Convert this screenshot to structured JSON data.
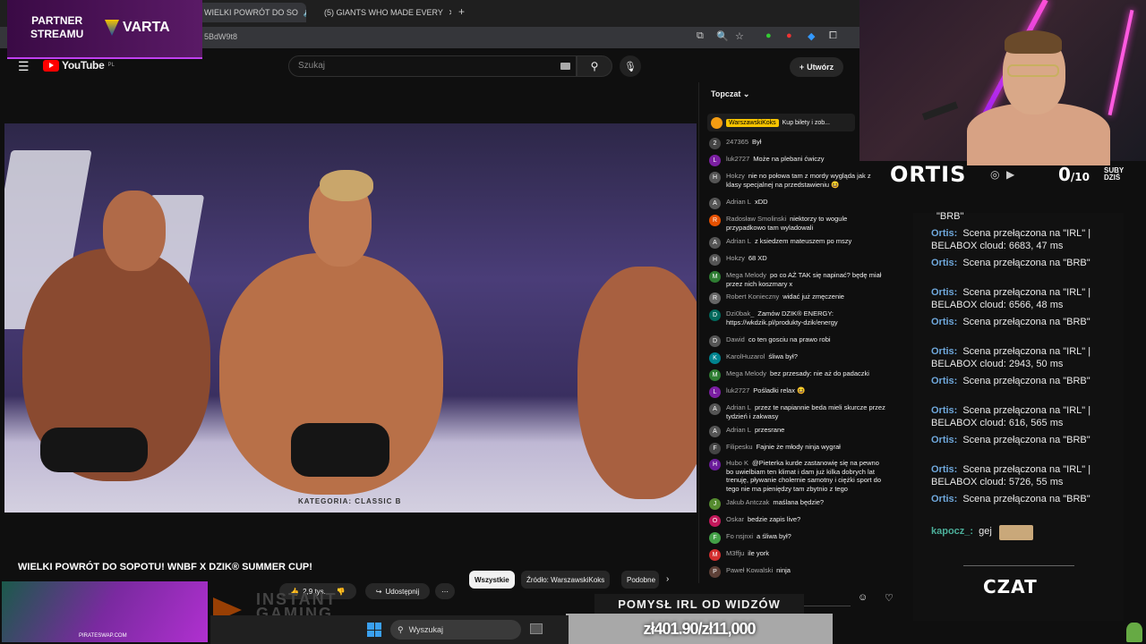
{
  "browser": {
    "tabs": [
      {
        "label": "WIELKI POWRÓT DO SO",
        "active": true
      },
      {
        "label": "(5) GIANTS WHO MADE EVERY",
        "active": false
      }
    ],
    "url_fragment": "5BdW9t8",
    "new_tab": "+"
  },
  "youtube": {
    "logo": "YouTube",
    "logo_region": "PL",
    "search_placeholder": "Szukaj",
    "create_label": "Utwórz"
  },
  "video": {
    "overlay_text": "KATEGORIA: CLASSIC B",
    "title": "WIELKI POWRÓT DO SOPOTU! WNBF X DZIK® SUMMER CUP!",
    "likes": "2,9 tys.",
    "share_label": "Udostępnij",
    "more": "⋯"
  },
  "chips": [
    "Wszystkie",
    "Źródło: WarszawskiKoks",
    "Podobne"
  ],
  "live_chat": {
    "header": "Topczat",
    "pinned": {
      "author": "WarszawskiKoks",
      "text": "Kup bilety i zob..."
    },
    "messages": [
      {
        "author": "247365",
        "text": "Był",
        "color": "#444"
      },
      {
        "author": "luk2727",
        "text": "Może na plebani ćwiczy",
        "color": "#7b1fa2"
      },
      {
        "author": "Hokzy",
        "text": "nie no połowa tam z mordy wygląda jak z klasy specjalnej na przedstawieniu 😆",
        "color": "#555"
      },
      {
        "author": "Adrian L",
        "text": "xDD",
        "color": "#555"
      },
      {
        "author": "Radosław Smolinski",
        "text": "niektorzy to wogule przypadkowo tam wyladowali",
        "color": "#e65100"
      },
      {
        "author": "Adrian L",
        "text": "z ksiedzem mateuszem po mszy",
        "color": "#555"
      },
      {
        "author": "Hokzy",
        "text": "68 XD",
        "color": "#555"
      },
      {
        "author": "Mega Melody",
        "text": "po co AŻ TAK się napinać? będę miał przez nich koszmary x",
        "color": "#2e7d32"
      },
      {
        "author": "Robert Konieczny",
        "text": "widać już zmęczenie",
        "color": "#666"
      },
      {
        "author": "Dzi0bak_",
        "text": "Zamów DZIK® ENERGY: https://wkdzik.pl/produkty-dzik/energy",
        "color": "#00695c"
      },
      {
        "author": "Dawid",
        "text": "co ten gosciu na prawo robi",
        "color": "#555"
      },
      {
        "author": "KarolHuzarol",
        "text": "śliwa był?",
        "color": "#00838f"
      },
      {
        "author": "Mega Melody",
        "text": "bez przesady: nie aż do padaczki",
        "color": "#2e7d32"
      },
      {
        "author": "luk2727",
        "text": "Pośladki relax 😆",
        "color": "#7b1fa2"
      },
      {
        "author": "Adrian L",
        "text": "przez te napiannie beda mieli skurcze przez tydzień i zakwasy",
        "color": "#555"
      },
      {
        "author": "Adrian L",
        "text": "przesrane",
        "color": "#555"
      },
      {
        "author": "Filipesku",
        "text": "Fajnie że młody ninja wygrał",
        "color": "#444"
      },
      {
        "author": "Hubo K",
        "text": "@Pieterka kurde zastanowię się na pewno bo uwielbiam ten klimat i dam już kilka dobrych lat trenuję, pływanie cholernie samotny i ciężki sport do tego nie ma pieniędzy tam zbytnio z tego",
        "color": "#6a1b9a"
      },
      {
        "author": "Jakub Antczak",
        "text": "maślana będzie?",
        "color": "#558b2f"
      },
      {
        "author": "Oskar",
        "text": "bedzie zapis live?",
        "color": "#c2185b"
      },
      {
        "author": "Fo nsjnxi",
        "text": "a śliwa był?",
        "color": "#43a047"
      },
      {
        "author": "M3ffju",
        "text": "ile york",
        "color": "#d32f2f"
      },
      {
        "author": "Paweł Kowalski",
        "text": "ninja",
        "color": "#5d4037"
      }
    ]
  },
  "stream_overlay": {
    "partner_text": "PARTNER\nSTREAMU",
    "sponsor": "VARTA",
    "streamer": "ORTIS",
    "subs_count": "0",
    "subs_goal": "/10",
    "subs_label_1": "SUBY",
    "subs_label_2": "DZIŚ",
    "chat_title": "CZAT",
    "bot_messages": [
      {
        "name": "",
        "text": "\"BRB\""
      },
      {
        "name": "Ortis:",
        "text": "Scena przełączona na \"IRL\" | BELABOX cloud: 6683, 47 ms"
      },
      {
        "name": "Ortis:",
        "text": "Scena przełączona na \"BRB\""
      },
      {
        "name": "Ortis:",
        "text": "Scena przełączona na \"IRL\" | BELABOX cloud: 6566, 48 ms"
      },
      {
        "name": "Ortis:",
        "text": "Scena przełączona na \"BRB\""
      },
      {
        "name": "Ortis:",
        "text": "Scena przełączona na \"IRL\" | BELABOX cloud: 2943, 50 ms"
      },
      {
        "name": "Ortis:",
        "text": "Scena przełączona na \"BRB\""
      },
      {
        "name": "Ortis:",
        "text": "Scena przełączona na \"IRL\" | BELABOX cloud: 616, 565 ms"
      },
      {
        "name": "Ortis:",
        "text": "Scena przełączona na \"BRB\""
      },
      {
        "name": "Ortis:",
        "text": "Scena przełączona na \"IRL\" | BELABOX cloud: 5726, 55 ms"
      },
      {
        "name": "Ortis:",
        "text": "Scena przełączona na \"BRB\""
      },
      {
        "name": "kapocz_:",
        "text": "gej"
      }
    ],
    "pirate": "PIRATESWAP.COM",
    "instant": "INSTANT\nGAMING",
    "idea_label": "POMYSŁ IRL OD WIDZÓW",
    "goal": "zł401.90/zł11,000"
  },
  "taskbar": {
    "search": "Wyszukaj"
  },
  "colors": {
    "accent": "#ff0000",
    "purple": "#c040f0",
    "chat_name": "#6fa8dc"
  }
}
